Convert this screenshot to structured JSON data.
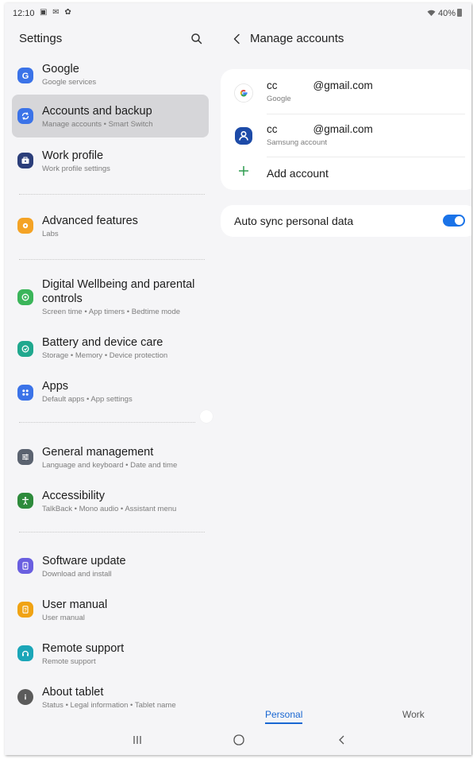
{
  "status_bar": {
    "time": "12:10",
    "left_icons": "▣ ✉ ✿",
    "battery": "40%"
  },
  "settings": {
    "title": "Settings",
    "items": [
      {
        "title": "Google",
        "subtitle": "Google services",
        "icon": "google-g-icon",
        "color": "#3b73e8"
      },
      {
        "title": "Accounts and backup",
        "subtitle": "Manage accounts  •  Smart Switch",
        "icon": "sync-icon",
        "color": "#3b73e8"
      },
      {
        "title": "Work profile",
        "subtitle": "Work profile settings",
        "icon": "briefcase-icon",
        "color": "#2b3e7a"
      },
      {
        "title": "Advanced features",
        "subtitle": "Labs",
        "icon": "gear-plus-icon",
        "color": "#f4a325"
      },
      {
        "title": "Digital Wellbeing and parental",
        "title2": "controls",
        "subtitle": "Screen time  •  App timers  •  Bedtime mode",
        "icon": "wellbeing-icon",
        "color": "#3bb55a"
      },
      {
        "title": "Battery and device care",
        "subtitle": "Storage  •  Memory  •  Device protection",
        "icon": "device-care-icon",
        "color": "#20a88e"
      },
      {
        "title": "Apps",
        "subtitle": "Default apps  •  App settings",
        "icon": "apps-grid-icon",
        "color": "#3b73e8"
      },
      {
        "title": "General management",
        "subtitle": "Language and keyboard  •  Date and time",
        "icon": "sliders-icon",
        "color": "#5b6370"
      },
      {
        "title": "Accessibility",
        "subtitle": "TalkBack  •  Mono audio  •  Assistant menu",
        "icon": "accessibility-icon",
        "color": "#2e8b3c"
      },
      {
        "title": "Software update",
        "subtitle": "Download and install",
        "icon": "software-update-icon",
        "color": "#6a5fe0"
      },
      {
        "title": "User manual",
        "subtitle": "User manual",
        "icon": "manual-icon",
        "color": "#f0a313"
      },
      {
        "title": "Remote support",
        "subtitle": "Remote support",
        "icon": "headset-icon",
        "color": "#1ba6b8"
      },
      {
        "title": "About tablet",
        "subtitle": "Status  •  Legal information  •  Tablet name",
        "icon": "info-icon",
        "color": "#5b5b5b"
      }
    ]
  },
  "manage_accounts": {
    "title": "Manage accounts",
    "accounts": [
      {
        "email": "cc            @gmail.com",
        "type": "Google",
        "icon": "google-logo-icon"
      },
      {
        "email": "cc            @gmail.com",
        "type": "Samsung account",
        "icon": "samsung-account-icon"
      }
    ],
    "add_account_label": "Add account",
    "auto_sync_label": "Auto sync personal data",
    "auto_sync_on": true,
    "tabs": {
      "personal": "Personal",
      "work": "Work"
    }
  },
  "nav": {
    "recents": "recents-icon",
    "home": "home-icon",
    "back": "back-icon"
  }
}
